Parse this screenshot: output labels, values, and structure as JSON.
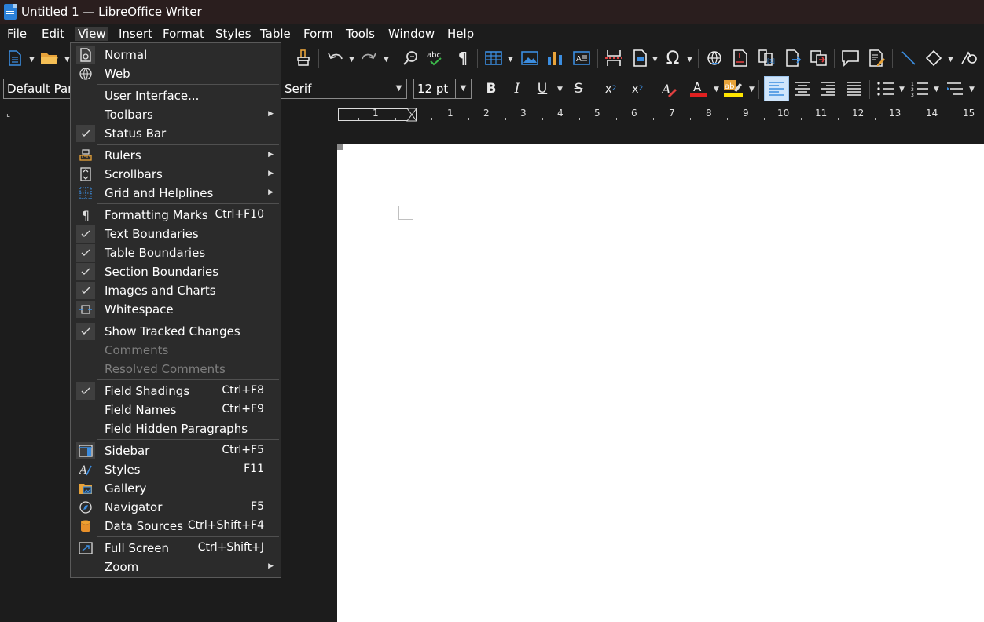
{
  "window": {
    "title": "Untitled 1 — LibreOffice Writer"
  },
  "menubar": [
    "File",
    "Edit",
    "View",
    "Insert",
    "Format",
    "Styles",
    "Table",
    "Form",
    "Tools",
    "Window",
    "Help"
  ],
  "formatting": {
    "paragraph_style": "Default Para",
    "font_name": "Serif",
    "font_size": "12 pt"
  },
  "ruler": {
    "numbers": [
      "1",
      "1",
      "2",
      "3",
      "4",
      "5",
      "6",
      "7",
      "8",
      "9",
      "10",
      "11",
      "12",
      "13",
      "14",
      "15"
    ]
  },
  "view_menu": {
    "items": [
      {
        "label": "Normal",
        "accel": "",
        "submenu": false,
        "disabled": false,
        "icon": "normal-view-icon",
        "checked": false
      },
      {
        "label": "Web",
        "accel": "",
        "submenu": false,
        "disabled": false,
        "icon": "globe-icon",
        "checked": false
      },
      {
        "label": "User Interface...",
        "accel": "",
        "submenu": false,
        "disabled": false,
        "icon": "",
        "checked": false
      },
      {
        "label": "Toolbars",
        "accel": "",
        "submenu": true,
        "disabled": false,
        "icon": "",
        "checked": false
      },
      {
        "label": "Status Bar",
        "accel": "",
        "submenu": false,
        "disabled": false,
        "icon": "checkmark-icon",
        "checked": true
      },
      {
        "label": "Rulers",
        "accel": "",
        "submenu": true,
        "disabled": false,
        "icon": "ruler-icon",
        "checked": false
      },
      {
        "label": "Scrollbars",
        "accel": "",
        "submenu": true,
        "disabled": false,
        "icon": "scrollbar-icon",
        "checked": false
      },
      {
        "label": "Grid and Helplines",
        "accel": "",
        "submenu": true,
        "disabled": false,
        "icon": "grid-icon",
        "checked": false
      },
      {
        "label": "Formatting Marks",
        "accel": "Ctrl+F10",
        "submenu": false,
        "disabled": false,
        "icon": "pilcrow-icon",
        "checked": false
      },
      {
        "label": "Text Boundaries",
        "accel": "",
        "submenu": false,
        "disabled": false,
        "icon": "checkmark-icon",
        "checked": true
      },
      {
        "label": "Table Boundaries",
        "accel": "",
        "submenu": false,
        "disabled": false,
        "icon": "checkmark-icon",
        "checked": true
      },
      {
        "label": "Section Boundaries",
        "accel": "",
        "submenu": false,
        "disabled": false,
        "icon": "checkmark-icon",
        "checked": true
      },
      {
        "label": "Images and Charts",
        "accel": "",
        "submenu": false,
        "disabled": false,
        "icon": "checkmark-icon",
        "checked": true
      },
      {
        "label": "Whitespace",
        "accel": "",
        "submenu": false,
        "disabled": false,
        "icon": "whitespace-icon",
        "checked": true
      },
      {
        "label": "Show Tracked Changes",
        "accel": "",
        "submenu": false,
        "disabled": false,
        "icon": "checkmark-icon",
        "checked": true
      },
      {
        "label": "Comments",
        "accel": "",
        "submenu": false,
        "disabled": true,
        "icon": "",
        "checked": false
      },
      {
        "label": "Resolved Comments",
        "accel": "",
        "submenu": false,
        "disabled": true,
        "icon": "",
        "checked": false
      },
      {
        "label": "Field Shadings",
        "accel": "Ctrl+F8",
        "submenu": false,
        "disabled": false,
        "icon": "checkmark-icon",
        "checked": true
      },
      {
        "label": "Field Names",
        "accel": "Ctrl+F9",
        "submenu": false,
        "disabled": false,
        "icon": "",
        "checked": false
      },
      {
        "label": "Field Hidden Paragraphs",
        "accel": "",
        "submenu": false,
        "disabled": false,
        "icon": "",
        "checked": false
      },
      {
        "label": "Sidebar",
        "accel": "Ctrl+F5",
        "submenu": false,
        "disabled": false,
        "icon": "sidebar-icon",
        "checked": true
      },
      {
        "label": "Styles",
        "accel": "F11",
        "submenu": false,
        "disabled": false,
        "icon": "styles-icon",
        "checked": false
      },
      {
        "label": "Gallery",
        "accel": "",
        "submenu": false,
        "disabled": false,
        "icon": "gallery-icon",
        "checked": false
      },
      {
        "label": "Navigator",
        "accel": "F5",
        "submenu": false,
        "disabled": false,
        "icon": "navigator-icon",
        "checked": false
      },
      {
        "label": "Data Sources",
        "accel": "Ctrl+Shift+F4",
        "submenu": false,
        "disabled": false,
        "icon": "database-icon",
        "checked": false
      },
      {
        "label": "Full Screen",
        "accel": "Ctrl+Shift+J",
        "submenu": false,
        "disabled": false,
        "icon": "fullscreen-icon",
        "checked": false
      },
      {
        "label": "Zoom",
        "accel": "",
        "submenu": true,
        "disabled": false,
        "icon": "",
        "checked": false
      }
    ]
  },
  "colors": {
    "font_color_bar": "#e02020",
    "highlight_color_bar": "#ffe600",
    "align_left_active": "#cfe5fb",
    "accent_blue": "#2b7fd8"
  }
}
